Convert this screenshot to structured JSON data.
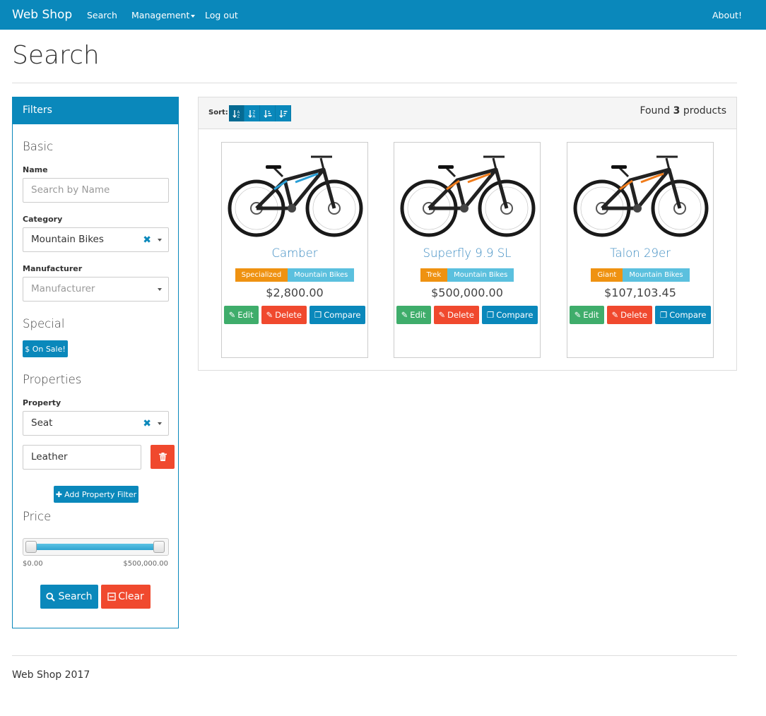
{
  "navbar": {
    "brand": "Web Shop",
    "items": [
      {
        "label": "Search"
      },
      {
        "label": "Management"
      },
      {
        "label": "Log out"
      }
    ],
    "about": "About!"
  },
  "page": {
    "title": "Search"
  },
  "filters": {
    "title": "Filters",
    "basic": {
      "title": "Basic",
      "name_label": "Name",
      "name_placeholder": "Search by Name",
      "category_label": "Category",
      "category_value": "Mountain Bikes",
      "manufacturer_label": "Manufacturer",
      "manufacturer_placeholder": "Manufacturer"
    },
    "special": {
      "title": "Special",
      "on_sale_label": "$ On Sale!"
    },
    "properties": {
      "title": "Properties",
      "property_label": "Property",
      "property_value": "Seat",
      "value_input": "Leather",
      "add_label": "Add Property Filter"
    },
    "price": {
      "title": "Price",
      "min_label": "$0.00",
      "max_label": "$500,000.00",
      "range_fraction": [
        0,
        1
      ]
    },
    "search_label": "Search",
    "clear_label": "Clear"
  },
  "results": {
    "sort_label": "Sort:",
    "found_prefix": "Found",
    "found_count": "3",
    "found_suffix": "products",
    "products": [
      {
        "name": "Camber",
        "manufacturer": "Specialized",
        "category": "Mountain Bikes",
        "price": "$2,800.00",
        "accent": "#2a9fd6"
      },
      {
        "name": "Superfly 9.9 SL",
        "manufacturer": "Trek",
        "category": "Mountain Bikes",
        "price": "$500,000.00",
        "accent": "#f07c1b"
      },
      {
        "name": "Talon 29er",
        "manufacturer": "Giant",
        "category": "Mountain Bikes",
        "price": "$107,103.45",
        "accent": "#f07c1b"
      }
    ],
    "actions": {
      "edit": "Edit",
      "delete": "Delete",
      "compare": "Compare"
    }
  },
  "footer": {
    "text": "Web Shop 2017"
  },
  "colors": {
    "primary": "#0a88bb",
    "danger": "#f0492e",
    "success": "#3fad6b",
    "warning": "#ef9211",
    "info": "#5bc0de"
  }
}
